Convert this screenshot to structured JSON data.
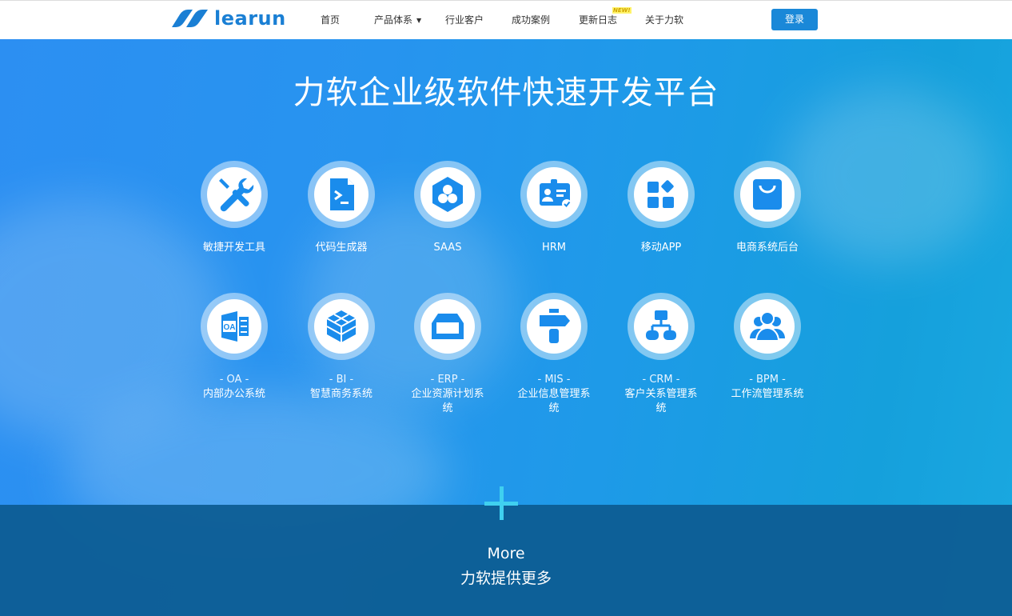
{
  "brand": {
    "name": "learun",
    "color": "#1a7fd4"
  },
  "nav": {
    "items": [
      {
        "label": "首页"
      },
      {
        "label": "产品体系",
        "has_dropdown": true,
        "dropdown_icon": "caret-down-icon"
      },
      {
        "label": "行业客户"
      },
      {
        "label": "成功案例"
      },
      {
        "label": "更新日志",
        "badge": "NEW!"
      },
      {
        "label": "关于力软"
      }
    ],
    "login_label": "登录",
    "login_color": "#1a88d8"
  },
  "hero": {
    "title": "力软企业级软件快速开发平台",
    "row1": [
      {
        "label": "敏捷开发工具",
        "icon": "tools-icon"
      },
      {
        "label": "代码生成器",
        "icon": "code-file-icon"
      },
      {
        "label": "SAAS",
        "icon": "saas-hexagon-icon"
      },
      {
        "label": "HRM",
        "icon": "id-card-icon"
      },
      {
        "label": "移动APP",
        "icon": "app-grid-icon"
      },
      {
        "label": "电商系统后台",
        "icon": "shopping-bag-icon"
      }
    ],
    "row2": [
      {
        "code": "- OA -",
        "desc": "内部办公系统",
        "icon": "oa-icon"
      },
      {
        "code": "- BI -",
        "desc": "智慧商务系统",
        "icon": "cube-icon"
      },
      {
        "code": "- ERP -",
        "desc": "企业资源计划系统",
        "icon": "inbox-tray-icon"
      },
      {
        "code": "- MIS -",
        "desc": "企业信息管理系统",
        "icon": "signpost-icon"
      },
      {
        "code": "- CRM -",
        "desc": "客户关系管理系统",
        "icon": "org-chart-icon"
      },
      {
        "code": "- BPM -",
        "desc": "工作流管理系统",
        "icon": "users-group-icon"
      }
    ]
  },
  "more": {
    "icon": "plus-icon",
    "title_en": "More",
    "title_cn": "力软提供更多"
  },
  "colors": {
    "accent": "#3fd0f0",
    "icon_blue": "#1a8cec"
  }
}
